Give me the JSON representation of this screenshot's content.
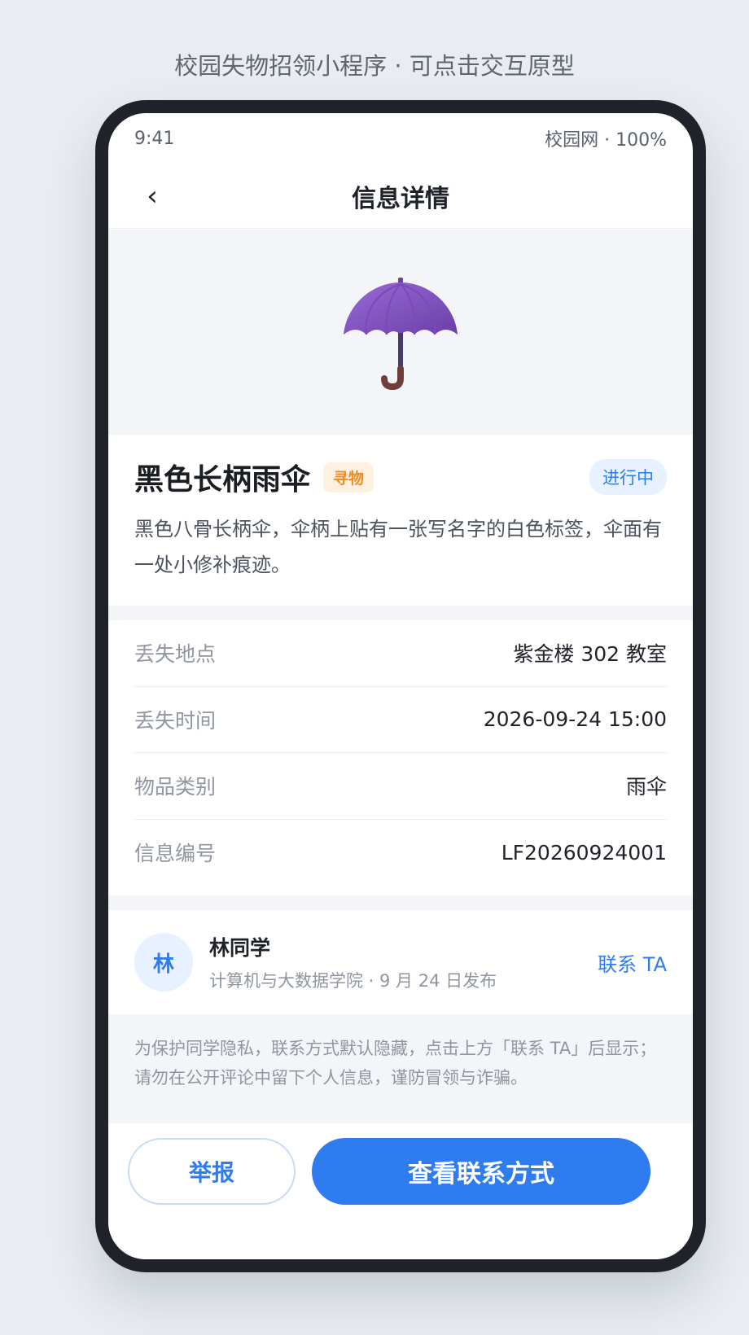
{
  "caption": "校园失物招领小程序 · 可点击交互原型",
  "status_bar": {
    "time": "9:41",
    "network": "校园网 · 100%"
  },
  "navbar": {
    "back_icon": "‹",
    "title": "信息详情"
  },
  "hero": {
    "image": "umbrella-icon"
  },
  "item": {
    "title": "黑色长柄雨伞",
    "type_tag": "寻物",
    "status_tag": "进行中",
    "description": "黑色八骨长柄伞，伞柄上贴有一张写名字的白色标签，伞面有一处小修补痕迹。"
  },
  "info": [
    {
      "label": "丢失地点",
      "value": "紫金楼 302 教室"
    },
    {
      "label": "丢失时间",
      "value": "2026-09-24 15:00"
    },
    {
      "label": "物品类别",
      "value": "雨伞"
    },
    {
      "label": "信息编号",
      "value": "LF20260924001"
    }
  ],
  "publisher": {
    "avatar_text": "林",
    "name": "林同学",
    "meta": "计算机与大数据学院 · 9 月 24 日发布",
    "contact_link": "联系 TA"
  },
  "notice": "为保护同学隐私，联系方式默认隐藏，点击上方「联系 TA」后显示；请勿在公开评论中留下个人信息，谨防冒领与诈骗。",
  "actions": {
    "report": "举报",
    "view_contact": "查看联系方式"
  },
  "colors": {
    "primary": "#2f7bf0",
    "tag_orange": "#f08a24",
    "umbrella": "#8a5cc4"
  }
}
